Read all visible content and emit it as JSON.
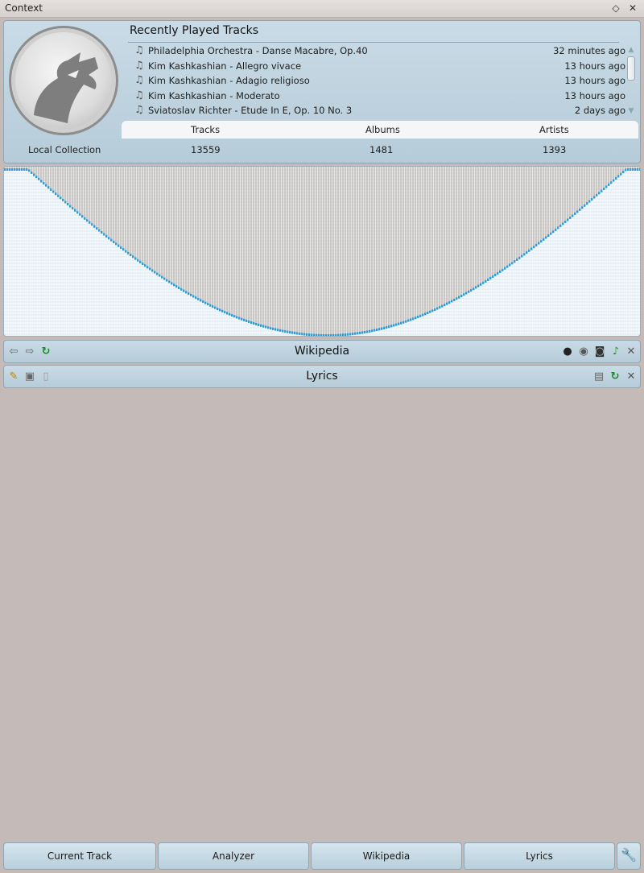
{
  "window": {
    "title": "Context",
    "restore_icon": "◇",
    "close_icon": "✕"
  },
  "recently_played": {
    "title": "Recently Played Tracks",
    "tracks": [
      {
        "name": "Philadelphia Orchestra - Danse Macabre, Op.40",
        "time": "32 minutes ago"
      },
      {
        "name": "Kim Kashkashian - Allegro vivace",
        "time": "13 hours ago"
      },
      {
        "name": "Kim Kashkashian - Adagio religioso",
        "time": "13 hours ago"
      },
      {
        "name": "Kim Kashkashian - Moderato",
        "time": "13 hours ago"
      },
      {
        "name": "Sviatoslav Richter - Etude In E, Op. 10 No. 3",
        "time": "2 days ago"
      }
    ],
    "note_icon": "♫"
  },
  "stats": {
    "headers": {
      "tracks": "Tracks",
      "albums": "Albums",
      "artists": "Artists"
    },
    "collection_label": "Local Collection",
    "values": {
      "tracks": "13559",
      "albums": "1481",
      "artists": "1393"
    }
  },
  "analyzer": {
    "accent": "#2a9bd6",
    "background": "#cdc9c6"
  },
  "wikipedia": {
    "title": "Wikipedia",
    "icons": [
      "back-icon",
      "forward-icon",
      "reload-icon",
      "artist-icon",
      "composer-icon",
      "album-icon",
      "track-icon",
      "settings-icon"
    ]
  },
  "lyrics": {
    "title": "Lyrics",
    "icons": [
      "edit-icon",
      "save-icon",
      "blank-page-icon",
      "layout-icon",
      "reload-icon",
      "settings-icon"
    ]
  },
  "tabs": {
    "current_track": "Current Track",
    "analyzer": "Analyzer",
    "wikipedia": "Wikipedia",
    "lyrics": "Lyrics",
    "config_icon": "wrench-icon"
  }
}
